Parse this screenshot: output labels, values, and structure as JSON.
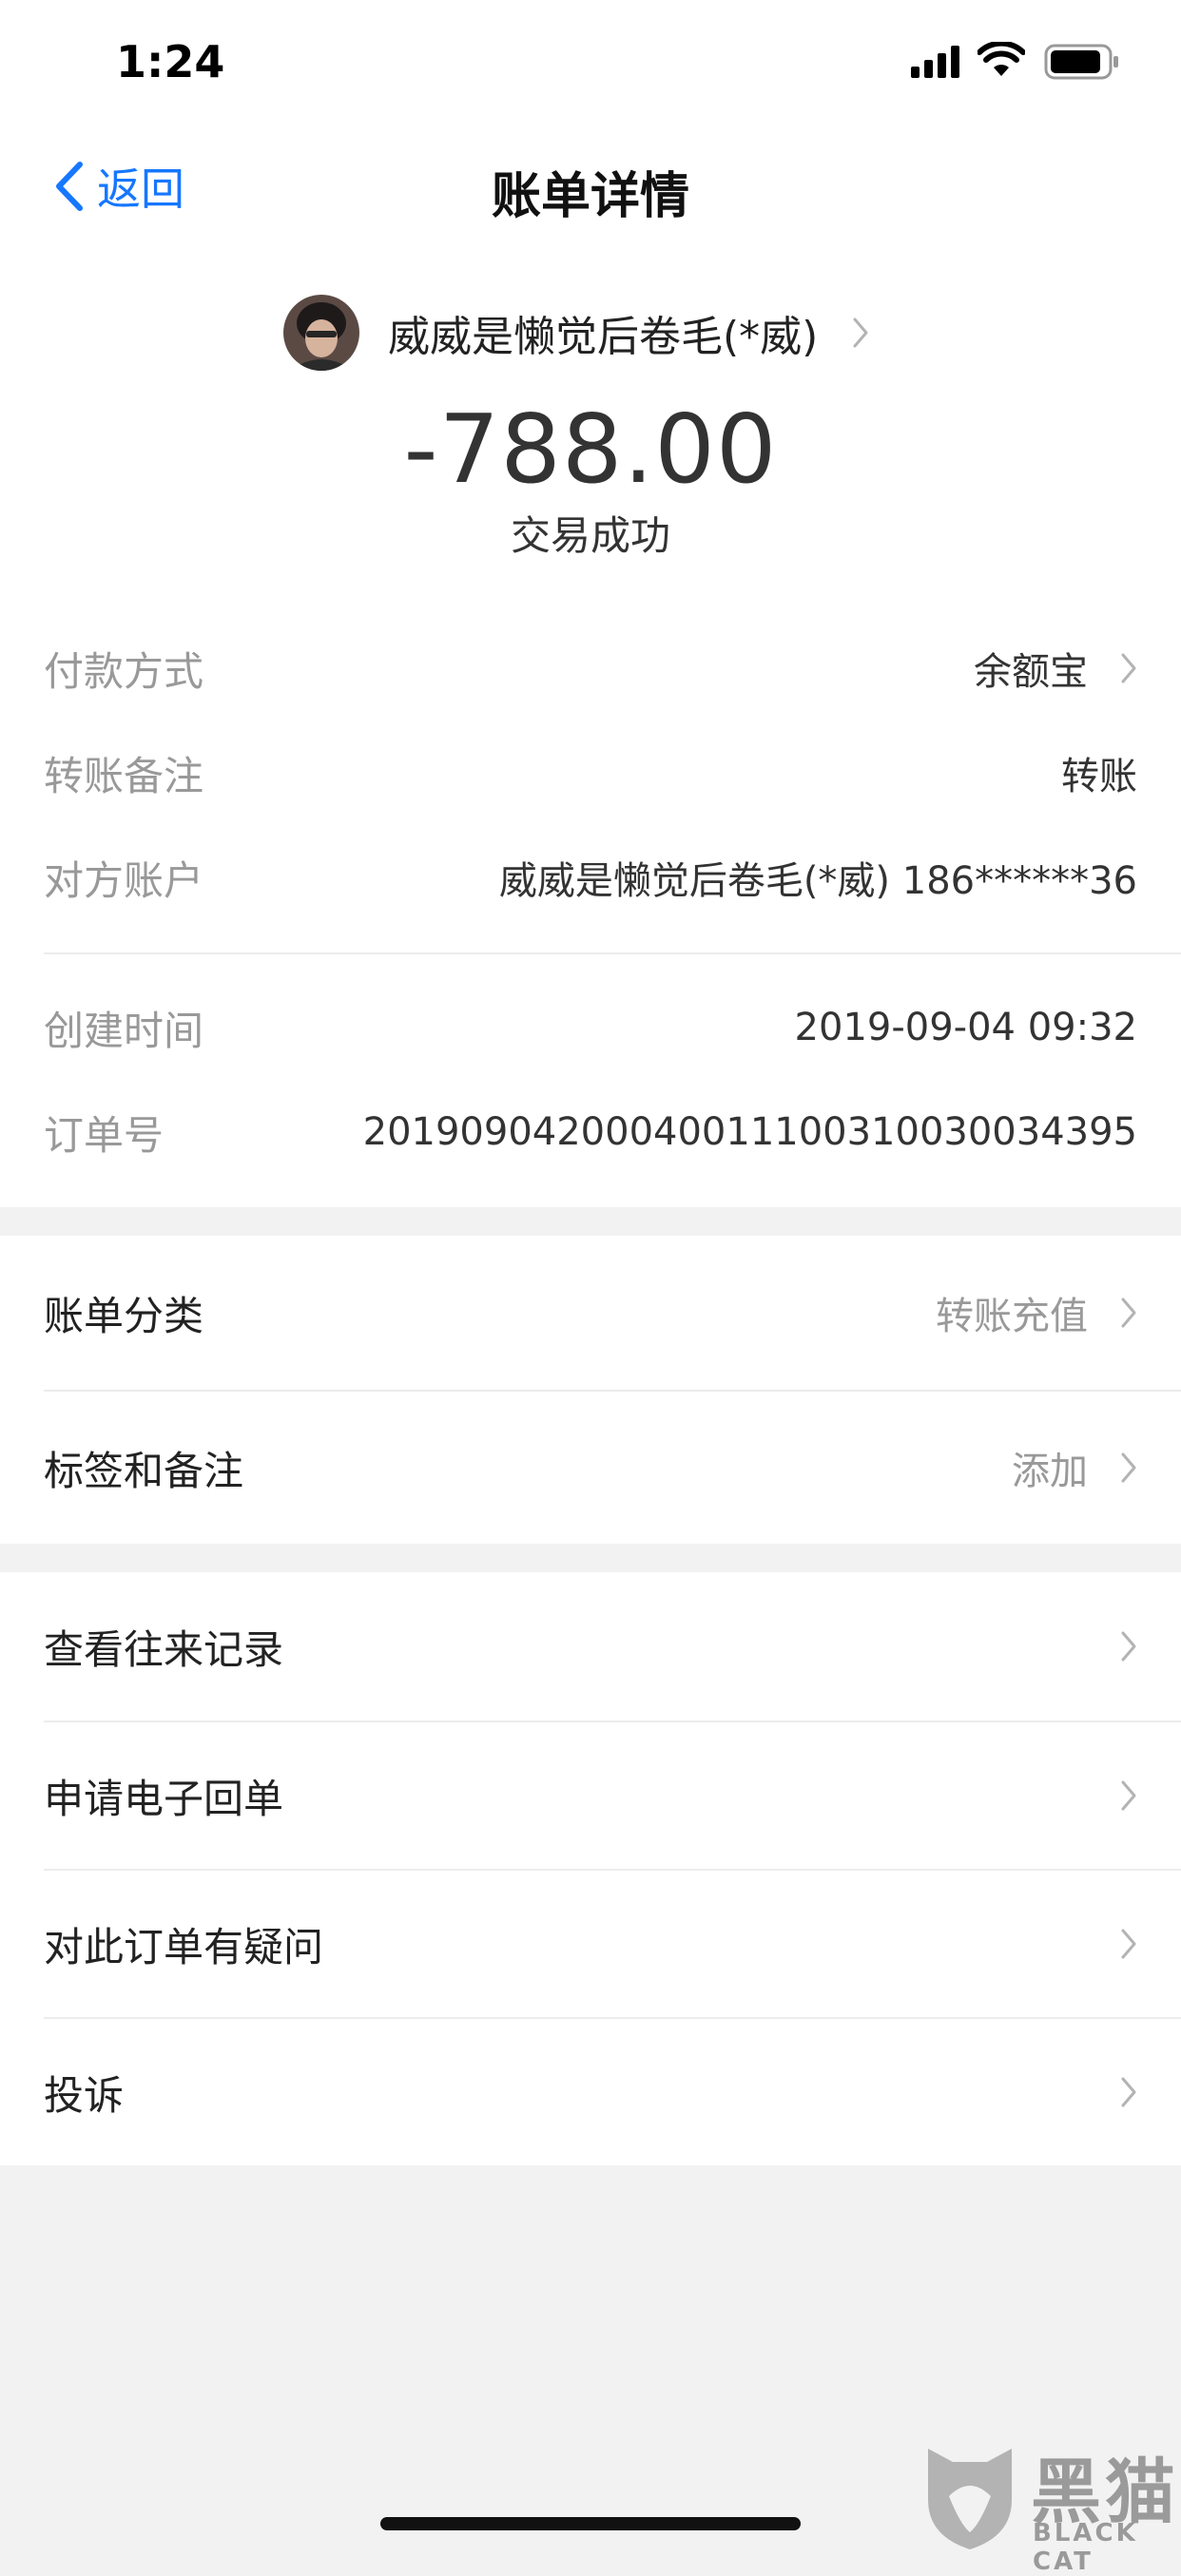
{
  "status_bar": {
    "time": "1:24"
  },
  "nav": {
    "back_label": "返回",
    "title": "账单详情"
  },
  "payee": {
    "name": "威威是懒觉后卷毛(*威)"
  },
  "transaction": {
    "amount": "-788.00",
    "status": "交易成功"
  },
  "details": [
    {
      "label": "付款方式",
      "value": "余额宝"
    },
    {
      "label": "转账备注",
      "value": "转账"
    },
    {
      "label": "对方账户",
      "value": "威威是懒觉后卷毛(*威) 186******36"
    },
    {
      "label": "创建时间",
      "value": "2019-09-04 09:32"
    },
    {
      "label": "订单号",
      "value": "20190904200040011100310030034395"
    }
  ],
  "classify": [
    {
      "label": "账单分类",
      "value": "转账充值"
    },
    {
      "label": "标签和备注",
      "value": "添加"
    }
  ],
  "actions": [
    {
      "label": "查看往来记录"
    },
    {
      "label": "申请电子回单"
    },
    {
      "label": "对此订单有疑问"
    },
    {
      "label": "投诉"
    }
  ],
  "watermark": {
    "cn": "黑猫",
    "en": "BLACK CAT"
  },
  "colors": {
    "accent": "#1677ff",
    "page_bg": "#f2f2f2",
    "muted": "#999999"
  }
}
